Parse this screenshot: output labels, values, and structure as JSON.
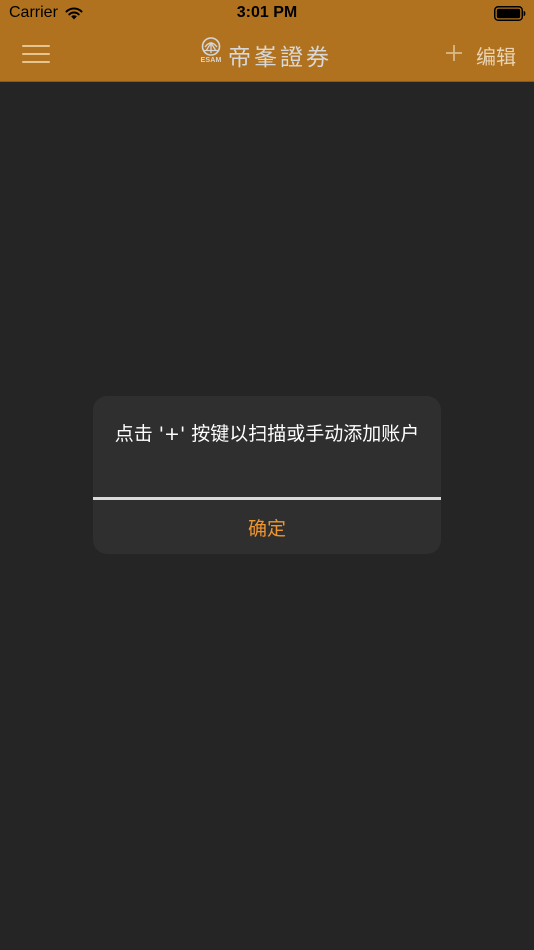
{
  "status_bar": {
    "carrier": "Carrier",
    "time": "3:01 PM",
    "wifi_icon": "wifi-icon",
    "battery_icon": "battery-full-icon"
  },
  "nav": {
    "menu_icon": "hamburger-menu-icon",
    "logo": {
      "emblem_text": "ESAM",
      "name": "帝峯證券"
    },
    "add_icon": "plus-icon",
    "edit_label": "编辑"
  },
  "alert": {
    "message": "点击 '+' 按键以扫描或手动添加账户",
    "confirm_label": "确定"
  },
  "colors": {
    "nav_background": "#b0721e",
    "page_background": "#252525",
    "alert_background": "#2f2f2f",
    "accent": "#f0962f",
    "edit_text": "#e9d3b2"
  }
}
